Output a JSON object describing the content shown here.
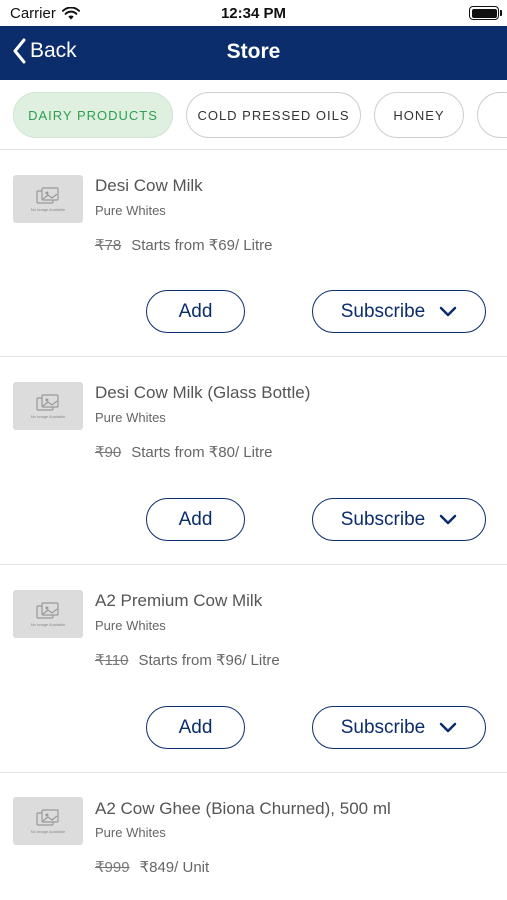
{
  "status": {
    "carrier": "Carrier",
    "time": "12:34 PM"
  },
  "nav": {
    "back_label": "Back",
    "title": "Store"
  },
  "tabs": [
    {
      "label": "DAIRY PRODUCTS",
      "active": true
    },
    {
      "label": "COLD PRESSED OILS",
      "active": false
    },
    {
      "label": "HONEY",
      "active": false
    }
  ],
  "thumb_caption": "No Image Available",
  "products": [
    {
      "name": "Desi Cow Milk",
      "brand": "Pure Whites",
      "mrp": "₹78",
      "price": "Starts from ₹69/ Litre",
      "add_label": "Add",
      "subscribe_label": "Subscribe"
    },
    {
      "name": "Desi Cow Milk (Glass Bottle)",
      "brand": "Pure Whites",
      "mrp": "₹90",
      "price": "Starts from ₹80/ Litre",
      "add_label": "Add",
      "subscribe_label": "Subscribe"
    },
    {
      "name": "A2 Premium Cow Milk",
      "brand": "Pure Whites",
      "mrp": "₹110",
      "price": "Starts from ₹96/ Litre",
      "add_label": "Add",
      "subscribe_label": "Subscribe"
    },
    {
      "name": "A2 Cow Ghee (Biona Churned), 500 ml",
      "brand": "Pure Whites",
      "mrp": "₹999",
      "price": "₹849/ Unit"
    }
  ],
  "colors": {
    "nav_background": "#0b2d6b",
    "active_tab_background": "#dff0e1",
    "active_tab_text": "#2e9e4f",
    "button_outline": "#0b2d6b"
  }
}
